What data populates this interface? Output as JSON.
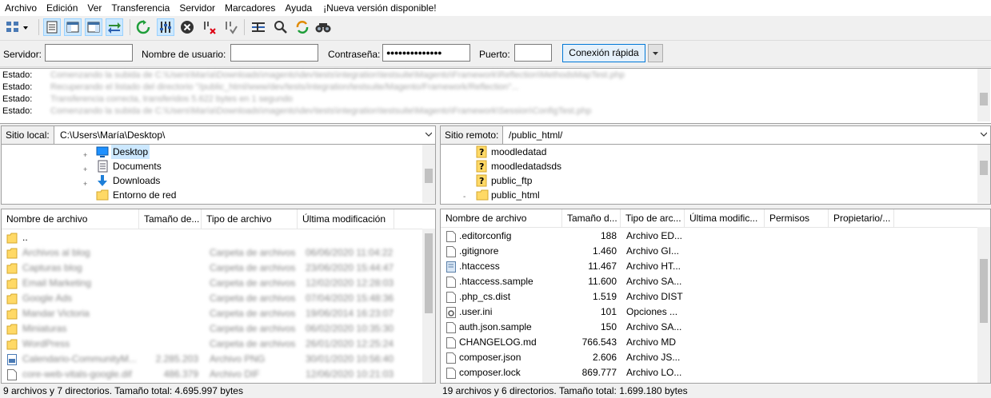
{
  "menu": [
    "Archivo",
    "Edición",
    "Ver",
    "Transferencia",
    "Servidor",
    "Marcadores",
    "Ayuda",
    "¡Nueva versión disponible!"
  ],
  "toolbar": {
    "icons": [
      "site-manager-icon",
      "toggle-log-icon",
      "toggle-local-tree-icon",
      "toggle-remote-tree-icon",
      "toggle-queue-icon",
      "refresh-icon",
      "process-queue-icon",
      "cancel-icon",
      "disconnect-icon",
      "reconnect-icon",
      "filename-filter-icon",
      "compare-icon",
      "sync-browse-icon",
      "search-icon"
    ]
  },
  "quickconnect": {
    "server_label": "Servidor:",
    "server_value": "",
    "user_label": "Nombre de usuario:",
    "user_value": "",
    "password_label": "Contraseña:",
    "password_value": "●●●●●●●●●●●●●●",
    "port_label": "Puerto:",
    "port_value": "",
    "connect_label": "Conexión rápida"
  },
  "log": [
    {
      "label": "Estado:",
      "message": "Comenzando la subida de C:\\Users\\María\\Downloads\\magento\\dev\\tests\\integration\\testsuite\\Magento\\Framework\\Reflection\\MethodsMapTest.php"
    },
    {
      "label": "Estado:",
      "message": "Recuperando el listado del directorio \"/public_html/www/dev/tests/integration/testsuite/Magento/Framework/Reflection\"..."
    },
    {
      "label": "Estado:",
      "message": "Transferencia correcta, transferidos 5.622 bytes en 1 segundo"
    },
    {
      "label": "Estado:",
      "message": "Comenzando la subida de C:\\Users\\María\\Downloads\\magento\\dev\\tests\\integration\\testsuite\\Magento\\Framework\\Session\\ConfigTest.php"
    }
  ],
  "local": {
    "site_label": "Sitio local:",
    "site_path": "C:\\Users\\María\\Desktop\\",
    "tree": [
      {
        "name": "Desktop",
        "icon": "desktop-folder-icon",
        "selected": true,
        "expander": "+"
      },
      {
        "name": "Documents",
        "icon": "documents-folder-icon",
        "selected": false,
        "expander": "+"
      },
      {
        "name": "Downloads",
        "icon": "downloads-folder-icon",
        "selected": false,
        "expander": "+"
      },
      {
        "name": "Entorno de red",
        "icon": "folder-icon",
        "selected": false,
        "expander": ""
      }
    ],
    "columns": [
      "Nombre de archivo",
      "Tamaño de...",
      "Tipo de archivo",
      "Última modificación"
    ],
    "files": [
      {
        "name": "..",
        "size": "",
        "type": "",
        "modified": "",
        "icon": "folder-icon"
      },
      {
        "name": "Archivos al blog",
        "size": "",
        "type": "Carpeta de archivos",
        "modified": "06/06/2020 11:04:22",
        "icon": "folder-icon"
      },
      {
        "name": "Capturas blog",
        "size": "",
        "type": "Carpeta de archivos",
        "modified": "23/06/2020 15:44:47",
        "icon": "folder-icon"
      },
      {
        "name": "Email Marketing",
        "size": "",
        "type": "Carpeta de archivos",
        "modified": "12/02/2020 12:28:03",
        "icon": "folder-icon"
      },
      {
        "name": "Google Ads",
        "size": "",
        "type": "Carpeta de archivos",
        "modified": "07/04/2020 15:48:36",
        "icon": "folder-icon"
      },
      {
        "name": "Mandar Victoria",
        "size": "",
        "type": "Carpeta de archivos",
        "modified": "19/06/2014 16:23:07",
        "icon": "folder-icon"
      },
      {
        "name": "Miniaturas",
        "size": "",
        "type": "Carpeta de archivos",
        "modified": "06/02/2020 10:35:30",
        "icon": "folder-icon"
      },
      {
        "name": "WordPress",
        "size": "",
        "type": "Carpeta de archivos",
        "modified": "26/01/2020 12:25:24",
        "icon": "folder-icon"
      },
      {
        "name": "Calendario-CommunityM...",
        "size": "2.285.203",
        "type": "Archivo PNG",
        "modified": "30/01/2020 10:56:40",
        "icon": "image-file-icon"
      },
      {
        "name": "core-web-vitals-google.dif",
        "size": "486.379",
        "type": "Archivo DIF",
        "modified": "12/06/2020 10:21:03",
        "icon": "file-icon"
      }
    ],
    "status": "9 archivos y 7 directorios. Tamaño total: 4.695.997 bytes"
  },
  "remote": {
    "site_label": "Sitio remoto:",
    "site_path": "/public_html/",
    "tree": [
      {
        "name": "moodledatad",
        "icon": "unknown-folder-icon",
        "expander": ""
      },
      {
        "name": "moodledatadsds",
        "icon": "unknown-folder-icon",
        "expander": ""
      },
      {
        "name": "public_ftp",
        "icon": "unknown-folder-icon",
        "expander": ""
      },
      {
        "name": "public_html",
        "icon": "folder-icon",
        "expander": "-"
      }
    ],
    "columns": [
      "Nombre de archivo",
      "Tamaño d...",
      "Tipo de arc...",
      "Última modific...",
      "Permisos",
      "Propietario/..."
    ],
    "files": [
      {
        "name": ".editorconfig",
        "size": "188",
        "type": "Archivo ED...",
        "icon": "file-icon"
      },
      {
        "name": ".gitignore",
        "size": "1.460",
        "type": "Archivo GI...",
        "icon": "file-icon"
      },
      {
        "name": ".htaccess",
        "size": "11.467",
        "type": "Archivo HT...",
        "icon": "htaccess-file-icon"
      },
      {
        "name": ".htaccess.sample",
        "size": "11.600",
        "type": "Archivo SA...",
        "icon": "file-icon"
      },
      {
        "name": ".php_cs.dist",
        "size": "1.519",
        "type": "Archivo DIST",
        "icon": "file-icon"
      },
      {
        "name": ".user.ini",
        "size": "101",
        "type": "Opciones ...",
        "icon": "settings-file-icon"
      },
      {
        "name": "auth.json.sample",
        "size": "150",
        "type": "Archivo SA...",
        "icon": "file-icon"
      },
      {
        "name": "CHANGELOG.md",
        "size": "766.543",
        "type": "Archivo MD",
        "icon": "file-icon"
      },
      {
        "name": "composer.json",
        "size": "2.606",
        "type": "Archivo JS...",
        "icon": "file-icon"
      },
      {
        "name": "composer.lock",
        "size": "869.777",
        "type": "Archivo LO...",
        "icon": "file-icon"
      }
    ],
    "status": "19 archivos y 6 directorios. Tamaño total: 1.699.180 bytes"
  },
  "colors": {
    "accent": "#0078d7",
    "folder": "#ffd966",
    "selection": "#cce8ff"
  }
}
